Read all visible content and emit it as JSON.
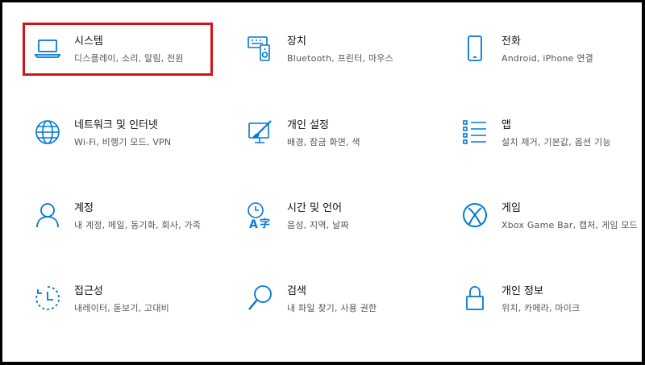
{
  "accent": "#0078d7",
  "highlight_color": "#d0121b",
  "settings": [
    {
      "id": "system",
      "icon": "laptop-icon",
      "title": "시스템",
      "desc": "디스플레이, 소리, 알림, 전원",
      "highlighted": true
    },
    {
      "id": "devices",
      "icon": "devices-icon",
      "title": "장치",
      "desc": "Bluetooth, 프린터, 마우스"
    },
    {
      "id": "phone",
      "icon": "phone-icon",
      "title": "전화",
      "desc": "Android, iPhone 연결"
    },
    {
      "id": "network",
      "icon": "globe-icon",
      "title": "네트워크 및 인터넷",
      "desc": "Wi-Fi, 비행기 모드, VPN"
    },
    {
      "id": "personalization",
      "icon": "paint-icon",
      "title": "개인 설정",
      "desc": "배경, 잠금 화면, 색"
    },
    {
      "id": "apps",
      "icon": "apps-list-icon",
      "title": "앱",
      "desc": "설치 제거, 기본값, 옵션 기능"
    },
    {
      "id": "accounts",
      "icon": "person-icon",
      "title": "계정",
      "desc": "내 계정, 메일, 동기화, 회사, 가족"
    },
    {
      "id": "time-language",
      "icon": "time-language-icon",
      "title": "시간 및 언어",
      "desc": "음성, 지역, 날짜"
    },
    {
      "id": "gaming",
      "icon": "xbox-icon",
      "title": "게임",
      "desc": "Xbox Game Bar, 캡처, 게임 모드"
    },
    {
      "id": "ease-of-access",
      "icon": "ease-of-access-icon",
      "title": "접근성",
      "desc": "내레이터, 돋보기, 고대비"
    },
    {
      "id": "search",
      "icon": "search-icon",
      "title": "검색",
      "desc": "내 파일 찾기, 사용 권한"
    },
    {
      "id": "privacy",
      "icon": "lock-icon",
      "title": "개인 정보",
      "desc": "위치, 카메라, 마이크"
    }
  ]
}
